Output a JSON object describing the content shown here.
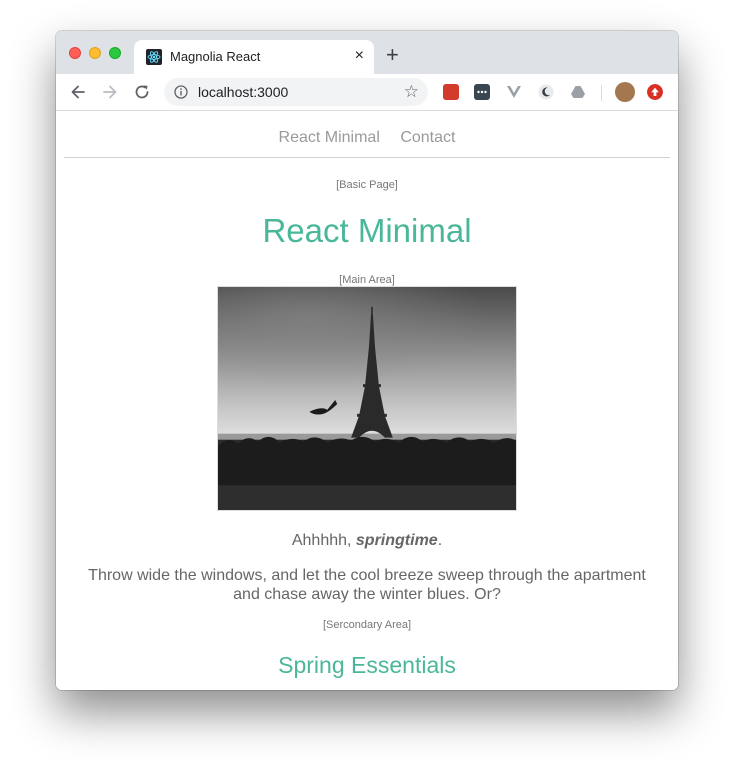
{
  "browser": {
    "tab_title": "Magnolia React",
    "tab_close": "×",
    "new_tab": "+",
    "url": "localhost:3000",
    "star": "☆"
  },
  "site": {
    "nav": [
      "React Minimal",
      "Contact"
    ],
    "basic_page_label": "[Basic Page]",
    "title": "React Minimal",
    "main_area_label": "[Main Area]",
    "intro_prefix": "Ahhhhh, ",
    "intro_emphasis": "springtime",
    "intro_suffix": ".",
    "paragraph": "Throw wide the windows, and let the cool breeze sweep through the apartment and chase away the winter blues. Or?",
    "secondary_area_label": "[Sercondary Area]",
    "section_title": "Spring Essentials"
  },
  "colors": {
    "accent": "#4bb79a",
    "nav_text": "#9a9a9a"
  }
}
